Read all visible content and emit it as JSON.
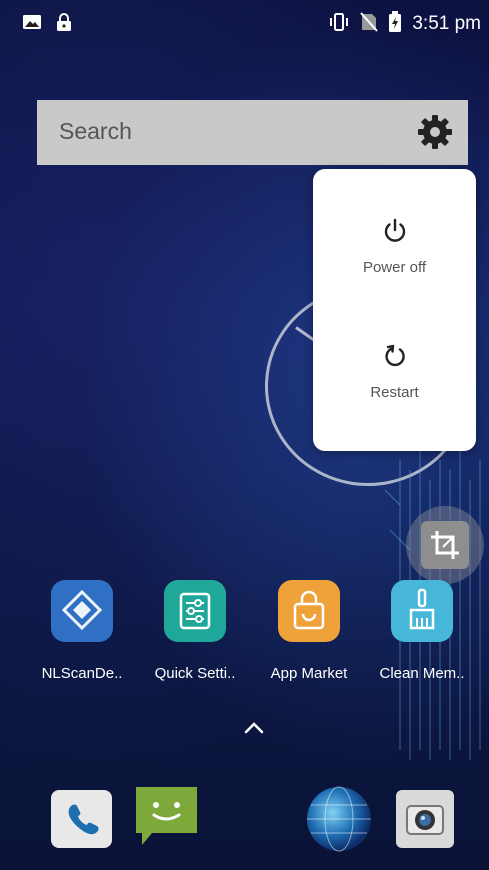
{
  "status_bar": {
    "time": "3:51 pm",
    "icons": [
      "image-icon",
      "lock-icon",
      "vibrate-icon",
      "no-sim-icon",
      "battery-charging-icon"
    ]
  },
  "search": {
    "placeholder": "Search",
    "settings_icon": "gear-icon"
  },
  "power_menu": {
    "items": [
      {
        "label": "Power off",
        "icon": "power-icon"
      },
      {
        "label": "Restart",
        "icon": "restart-icon"
      }
    ]
  },
  "apps": [
    {
      "label": "NLScanDe..",
      "icon": "nlscan-icon",
      "color": "#2f6fc4"
    },
    {
      "label": "Quick Setti..",
      "icon": "sliders-icon",
      "color": "#1fa89a"
    },
    {
      "label": "App Market",
      "icon": "shopping-bag-icon",
      "color": "#f0a23a"
    },
    {
      "label": "Clean Mem..",
      "icon": "broom-icon",
      "color": "#46b7d8"
    }
  ],
  "dock": [
    {
      "icon": "phone-icon"
    },
    {
      "icon": "messages-icon"
    },
    {
      "icon": "browser-globe-icon"
    },
    {
      "icon": "camera-icon"
    }
  ],
  "colors": {
    "menu_background": "#ffffff",
    "search_background": "#c9c9c9",
    "menu_text": "#555555"
  }
}
